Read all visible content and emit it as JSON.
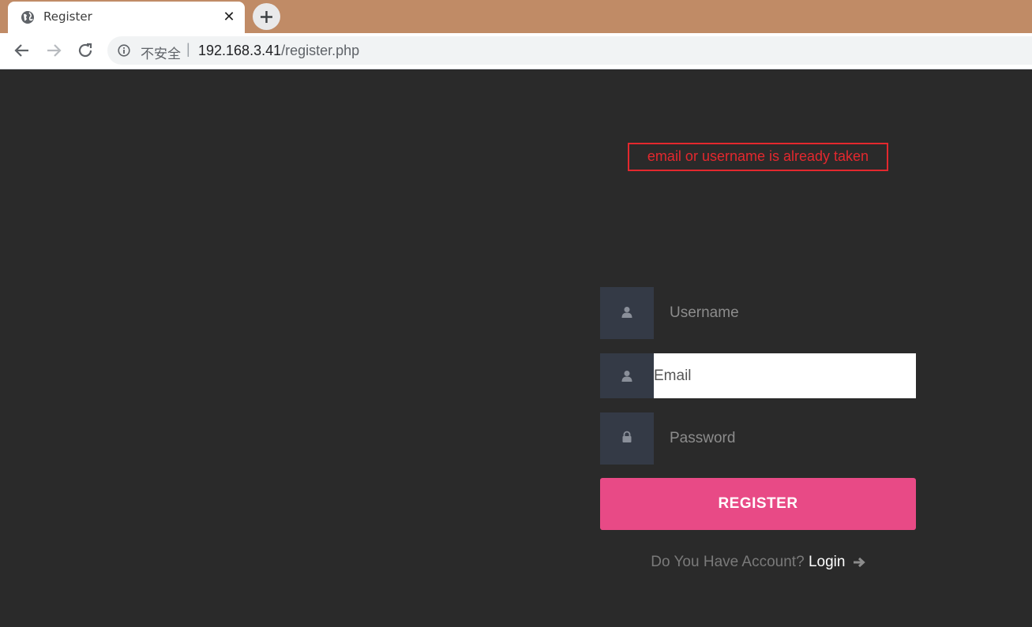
{
  "browser": {
    "tab_title": "Register",
    "tab_close": "✕",
    "security_label": "不安全",
    "separator": "|",
    "url_host": "192.168.3.41",
    "url_path": "/register.php"
  },
  "page": {
    "error_message": "email or username is already taken",
    "fields": {
      "username_placeholder": "Username",
      "email_value": "Email",
      "password_placeholder": "Password"
    },
    "register_label": "REGISTER",
    "account_prompt": "Do You Have Account?",
    "login_label": "Login"
  },
  "icons": {
    "user": "user-icon",
    "lock": "lock-icon",
    "arrow": "arrow-right-icon"
  },
  "colors": {
    "page_bg": "#2a2a2a",
    "error": "#e3282e",
    "accent": "#e84a86",
    "icon_bg": "#343a46"
  }
}
